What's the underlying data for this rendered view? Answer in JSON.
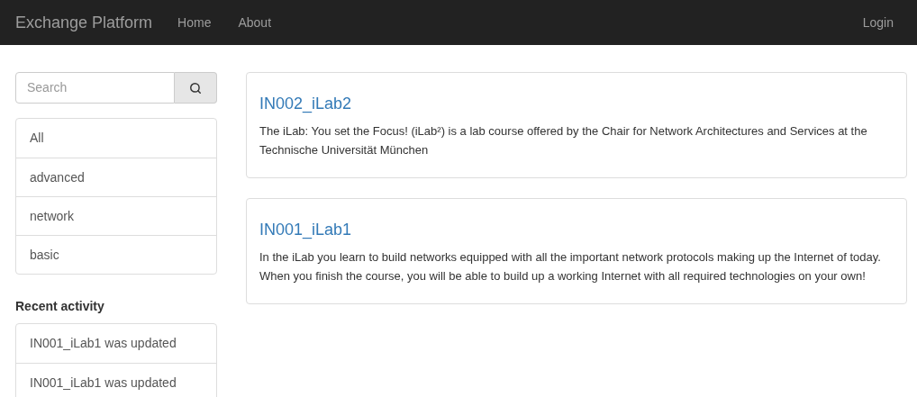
{
  "navbar": {
    "brand": "Exchange Platform",
    "links": [
      {
        "label": "Home"
      },
      {
        "label": "About"
      }
    ],
    "login": "Login"
  },
  "search": {
    "placeholder": "Search"
  },
  "categories": [
    {
      "label": "All"
    },
    {
      "label": "advanced"
    },
    {
      "label": "network"
    },
    {
      "label": "basic"
    }
  ],
  "recent_activity": {
    "heading": "Recent activity",
    "items": [
      "IN001_iLab1 was updated",
      "IN001_iLab1 was updated"
    ]
  },
  "courses": [
    {
      "title": "IN002_iLab2",
      "description": "The iLab: You set the Focus! (iLab²) is a lab course offered by the Chair for Network Architectures and Services at the Technische Universität München"
    },
    {
      "title": "IN001_iLab1",
      "description": "In the iLab you learn to build networks equipped with all the important network protocols making up the Internet of today. When you finish the course, you will be able to build up a working Internet with all required technologies on your own!"
    }
  ]
}
